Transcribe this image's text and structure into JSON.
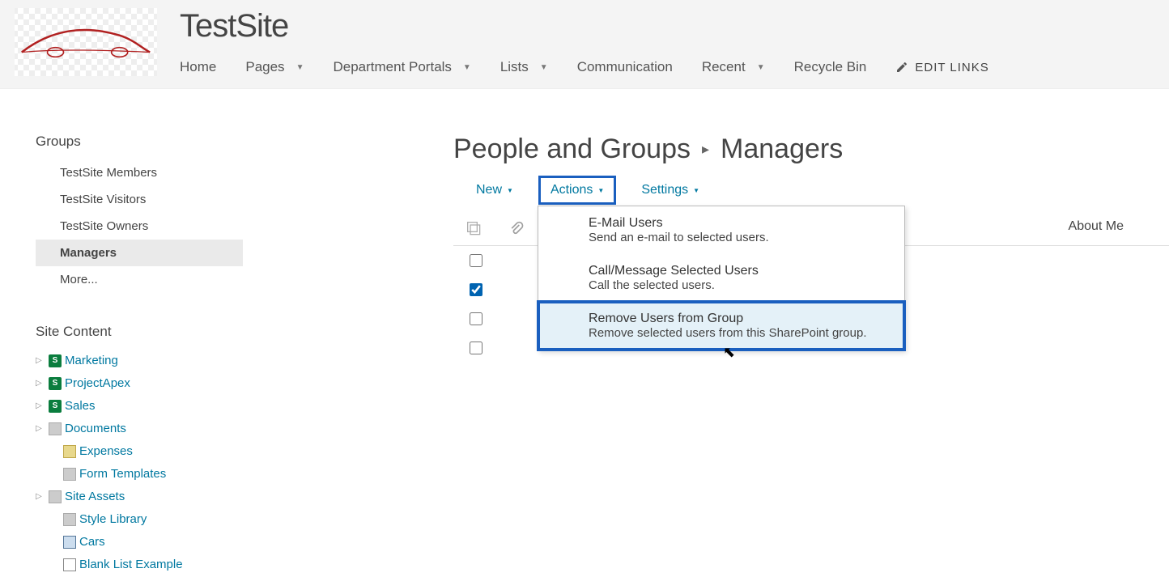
{
  "header": {
    "site_title": "TestSite",
    "nav": [
      {
        "label": "Home",
        "dd": false
      },
      {
        "label": "Pages",
        "dd": true
      },
      {
        "label": "Department Portals",
        "dd": true
      },
      {
        "label": "Lists",
        "dd": true
      },
      {
        "label": "Communication",
        "dd": false
      },
      {
        "label": "Recent",
        "dd": true
      },
      {
        "label": "Recycle Bin",
        "dd": false
      }
    ],
    "edit_links": "EDIT LINKS"
  },
  "sidebar": {
    "groups_heading": "Groups",
    "groups": [
      {
        "label": "TestSite Members",
        "active": false
      },
      {
        "label": "TestSite Visitors",
        "active": false
      },
      {
        "label": "TestSite Owners",
        "active": false
      },
      {
        "label": "Managers",
        "active": true
      },
      {
        "label": "More...",
        "active": false
      }
    ],
    "site_content_heading": "Site Content",
    "tree": [
      {
        "label": "Marketing",
        "icon": "sp",
        "expand": true,
        "indent": 0
      },
      {
        "label": "ProjectApex",
        "icon": "sp",
        "expand": true,
        "indent": 0
      },
      {
        "label": "Sales",
        "icon": "sp",
        "expand": true,
        "indent": 0
      },
      {
        "label": "Documents",
        "icon": "doc",
        "expand": true,
        "indent": 0
      },
      {
        "label": "Expenses",
        "icon": "fold",
        "expand": false,
        "indent": 1
      },
      {
        "label": "Form Templates",
        "icon": "doc",
        "expand": false,
        "indent": 1
      },
      {
        "label": "Site Assets",
        "icon": "doc",
        "expand": true,
        "indent": 0
      },
      {
        "label": "Style Library",
        "icon": "doc",
        "expand": false,
        "indent": 1
      },
      {
        "label": "Cars",
        "icon": "pic",
        "expand": false,
        "indent": 1
      },
      {
        "label": "Blank List Example",
        "icon": "grid",
        "expand": false,
        "indent": 1
      }
    ]
  },
  "main": {
    "breadcrumb_parent": "People and Groups",
    "breadcrumb_current": "Managers",
    "toolbar": {
      "new": "New",
      "actions": "Actions",
      "settings": "Settings"
    },
    "about_me": "About Me",
    "rows": [
      {
        "checked": false
      },
      {
        "checked": true
      },
      {
        "checked": false
      },
      {
        "checked": false
      }
    ],
    "dropdown": [
      {
        "title": "E-Mail Users",
        "desc": "Send an e-mail to selected users.",
        "hover": false
      },
      {
        "title": "Call/Message Selected Users",
        "desc": "Call the selected users.",
        "hover": false
      },
      {
        "title": "Remove Users from Group",
        "desc": "Remove selected users from this SharePoint group.",
        "hover": true
      }
    ]
  }
}
